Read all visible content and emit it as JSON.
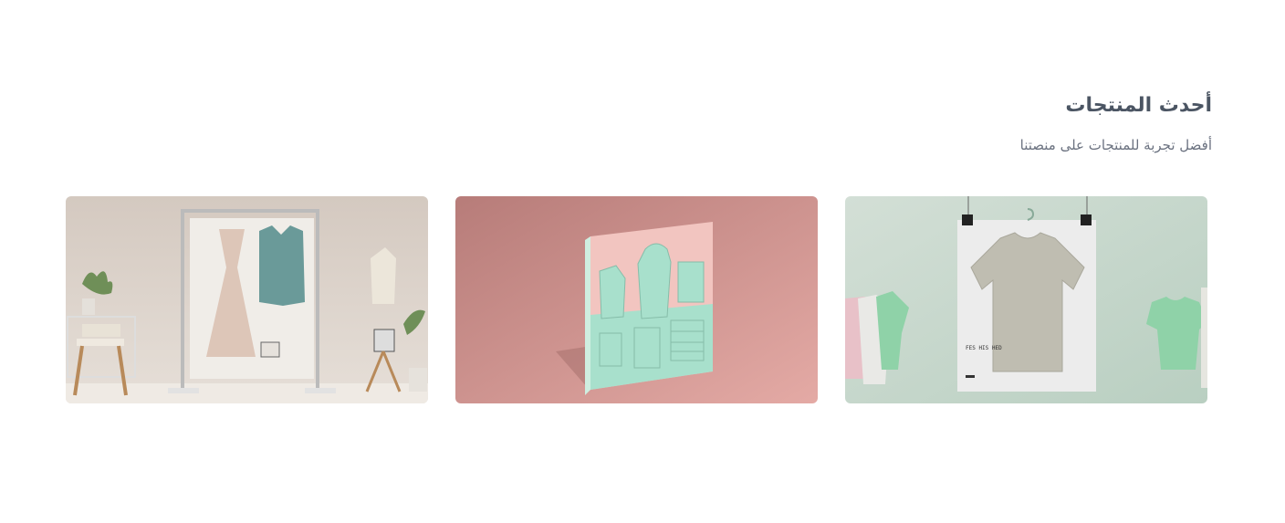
{
  "section": {
    "title": "أحدث المنتجات",
    "subtitle": "أفضل تجربة للمنتجات على منصتنا"
  },
  "products": [
    {
      "icon": "tshirt-poster-image",
      "poster_text": "FES HIS HED"
    },
    {
      "icon": "clothing-model-image"
    },
    {
      "icon": "clothing-rack-image"
    }
  ],
  "colors": {
    "title": "#4b5563",
    "subtitle": "#6b7280",
    "card1_bg": "#c9d9cf",
    "card2_bg": "#c58a86",
    "card3_bg": "#d6cbc2"
  }
}
